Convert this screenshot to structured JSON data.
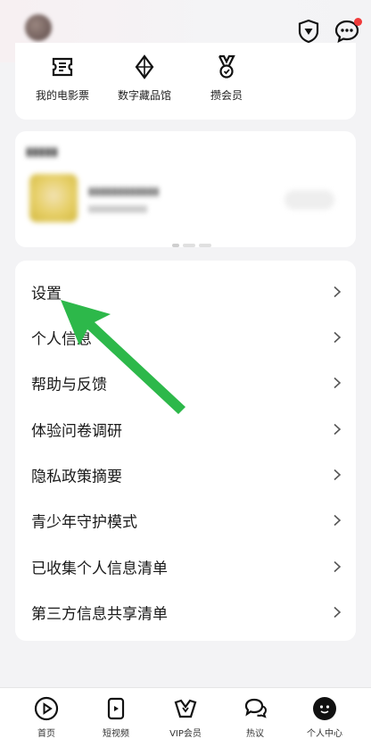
{
  "quick_links": [
    {
      "label": "我的电影票",
      "icon": "ticket-icon"
    },
    {
      "label": "数字藏品馆",
      "icon": "diamond-icon"
    },
    {
      "label": "攒会员",
      "icon": "medal-icon"
    }
  ],
  "menu": [
    {
      "label": "设置"
    },
    {
      "label": "个人信息"
    },
    {
      "label": "帮助与反馈"
    },
    {
      "label": "体验问卷调研"
    },
    {
      "label": "隐私政策摘要"
    },
    {
      "label": "青少年守护模式"
    },
    {
      "label": "已收集个人信息清单"
    },
    {
      "label": "第三方信息共享清单"
    }
  ],
  "tabs": [
    {
      "label": "首页",
      "icon": "play-circle-icon"
    },
    {
      "label": "短视频",
      "icon": "short-video-icon"
    },
    {
      "label": "VIP会员",
      "icon": "vip-crown-icon"
    },
    {
      "label": "热议",
      "icon": "discuss-icon"
    },
    {
      "label": "个人中心",
      "icon": "profile-icon"
    }
  ],
  "colors": {
    "accent_arrow": "#2db84a",
    "notification_dot": "#f03b3b"
  }
}
